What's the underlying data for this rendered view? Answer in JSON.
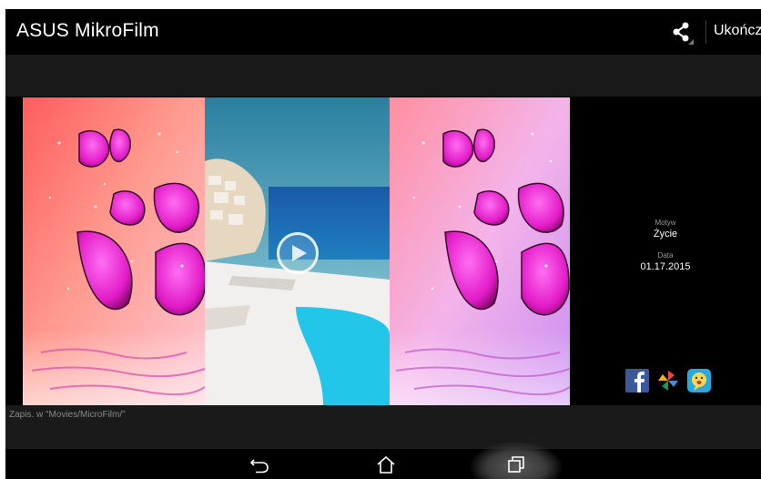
{
  "header": {
    "title": "ASUS MikroFilm",
    "done_label": "Ukończ"
  },
  "info": {
    "theme_label": "Motyw",
    "theme_value": "Życie",
    "date_label": "Data",
    "date_value": "01.17.2015"
  },
  "status": {
    "saved_path": "Zapis. w \"Movies/MicroFilm/\""
  },
  "icons": {
    "share": "share-icon",
    "play": "play-icon",
    "facebook": "facebook-icon",
    "photos": "pinwheel-icon",
    "messenger": "chat-icon",
    "back": "back-icon",
    "home": "home-icon",
    "recents": "recents-icon"
  },
  "colors": {
    "facebook": "#3b5998",
    "messenger": "#29a9e1"
  }
}
